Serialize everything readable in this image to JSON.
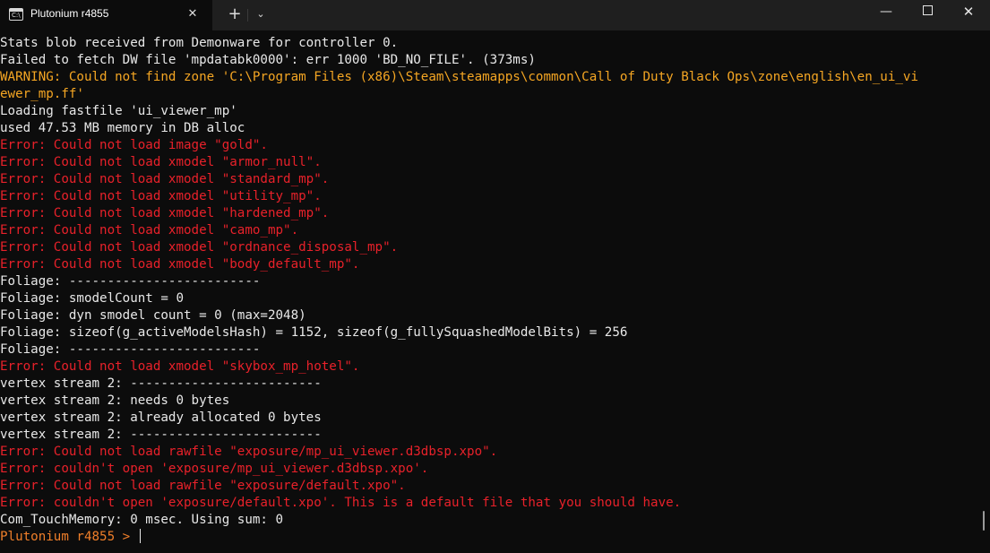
{
  "window": {
    "tab_title": "Plutonium r4855",
    "tab_close": "✕",
    "new_tab": "+",
    "dropdown": "⌄",
    "minimize": "—",
    "close": "✕"
  },
  "console": {
    "lines": [
      {
        "text": "Stats blob received from Demonware for controller 0.",
        "level": "info"
      },
      {
        "text": "Failed to fetch DW file 'mpdatabk0000': err 1000 'BD_NO_FILE'. (373ms)",
        "level": "info"
      },
      {
        "text": "WARNING: Could not find zone 'C:\\Program Files (x86)\\Steam\\steamapps\\common\\Call of Duty Black Ops\\zone\\english\\en_ui_vi",
        "level": "warn"
      },
      {
        "text": "ewer_mp.ff'",
        "level": "warn"
      },
      {
        "text": "Loading fastfile 'ui_viewer_mp'",
        "level": "info"
      },
      {
        "text": "used 47.53 MB memory in DB alloc",
        "level": "info"
      },
      {
        "text": "Error: Could not load image \"gold\".",
        "level": "err"
      },
      {
        "text": "Error: Could not load xmodel \"armor_null\".",
        "level": "err"
      },
      {
        "text": "Error: Could not load xmodel \"standard_mp\".",
        "level": "err"
      },
      {
        "text": "Error: Could not load xmodel \"utility_mp\".",
        "level": "err"
      },
      {
        "text": "Error: Could not load xmodel \"hardened_mp\".",
        "level": "err"
      },
      {
        "text": "Error: Could not load xmodel \"camo_mp\".",
        "level": "err"
      },
      {
        "text": "Error: Could not load xmodel \"ordnance_disposal_mp\".",
        "level": "err"
      },
      {
        "text": "Error: Could not load xmodel \"body_default_mp\".",
        "level": "err"
      },
      {
        "text": "Foliage: -------------------------",
        "level": "info"
      },
      {
        "text": "Foliage: smodelCount = 0",
        "level": "info"
      },
      {
        "text": "Foliage: dyn smodel count = 0 (max=2048)",
        "level": "info"
      },
      {
        "text": "Foliage: sizeof(g_activeModelsHash) = 1152, sizeof(g_fullySquashedModelBits) = 256",
        "level": "info"
      },
      {
        "text": "Foliage: -------------------------",
        "level": "info"
      },
      {
        "text": "Error: Could not load xmodel \"skybox_mp_hotel\".",
        "level": "err"
      },
      {
        "text": "vertex stream 2: -------------------------",
        "level": "info"
      },
      {
        "text": "vertex stream 2: needs 0 bytes",
        "level": "info"
      },
      {
        "text": "vertex stream 2: already allocated 0 bytes",
        "level": "info"
      },
      {
        "text": "vertex stream 2: -------------------------",
        "level": "info"
      },
      {
        "text": "Error: Could not load rawfile \"exposure/mp_ui_viewer.d3dbsp.xpo\".",
        "level": "err"
      },
      {
        "text": "Error: couldn't open 'exposure/mp_ui_viewer.d3dbsp.xpo'.",
        "level": "err"
      },
      {
        "text": "Error: Could not load rawfile \"exposure/default.xpo\".",
        "level": "err"
      },
      {
        "text": "Error: couldn't open 'exposure/default.xpo'. This is a default file that you should have.",
        "level": "err"
      },
      {
        "text": "Com_TouchMemory: 0 msec. Using sum: 0",
        "level": "info"
      }
    ],
    "prompt": "Plutonium r4855 > "
  },
  "colors": {
    "background": "#0c0c0c",
    "info": "#e8e8e8",
    "warn": "#f5a623",
    "error": "#e8212a",
    "prompt": "#f07f2a"
  }
}
